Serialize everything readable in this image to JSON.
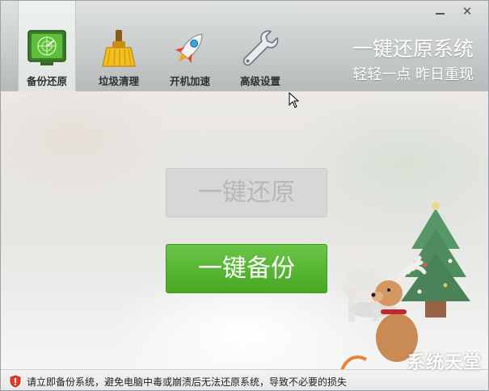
{
  "window": {
    "controls": {
      "minimize_icon": "minimize-icon",
      "close_icon": "close-icon"
    }
  },
  "toolbar": {
    "items": [
      {
        "label": "备份还原",
        "icon": "radar-screen-icon",
        "active": true
      },
      {
        "label": "垃圾清理",
        "icon": "broom-icon",
        "active": false
      },
      {
        "label": "开机加速",
        "icon": "rocket-icon",
        "active": false
      },
      {
        "label": "高级设置",
        "icon": "wrench-icon",
        "active": false
      }
    ]
  },
  "brand": {
    "title": "一键还原系统",
    "subtitle": "轻轻一点 昨日重现"
  },
  "main": {
    "restore_label": "一键还原",
    "backup_label": "一键备份"
  },
  "status": {
    "icon": "shield-warning-icon",
    "text": "请立即备份系统，避免电脑中毒或崩溃后无法还原系统，导致不必要的损失"
  },
  "watermark": {
    "text": "系统天堂"
  },
  "colors": {
    "accent_green": "#4fb22b",
    "header_gray": "#c9cccc",
    "disabled_button": "#d7d7d7"
  }
}
